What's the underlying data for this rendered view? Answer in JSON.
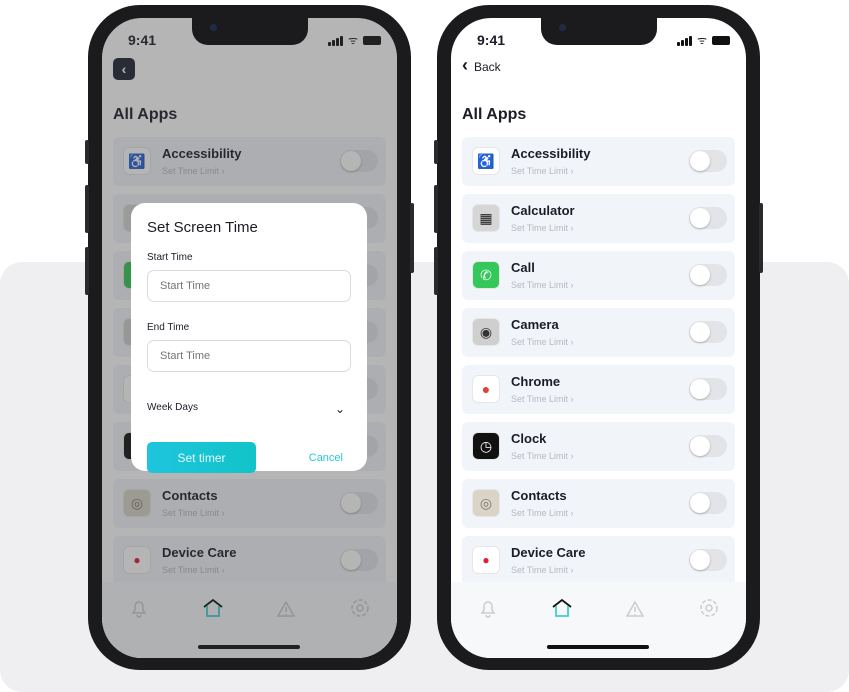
{
  "status": {
    "time": "9:41"
  },
  "header": {
    "back_label": "Back",
    "title": "All Apps"
  },
  "apps": [
    {
      "name": "Accessibility",
      "sub": "Set Time Limit",
      "icon": "accessibility-icon",
      "glyph": "♿",
      "bg": "#ffffff",
      "fg": "#3b82f6"
    },
    {
      "name": "Calculator",
      "sub": "Set Time Limit",
      "icon": "calculator-icon",
      "glyph": "▦",
      "bg": "#d6d6d6",
      "fg": "#222"
    },
    {
      "name": "Call",
      "sub": "Set Time Limit",
      "icon": "phone-icon",
      "glyph": "✆",
      "bg": "#34c759",
      "fg": "#fff"
    },
    {
      "name": "Camera",
      "sub": "Set Time Limit",
      "icon": "camera-icon",
      "glyph": "◉",
      "bg": "#cfcfcf",
      "fg": "#333"
    },
    {
      "name": "Chrome",
      "sub": "Set Time Limit",
      "icon": "chrome-icon",
      "glyph": "●",
      "bg": "#ffffff",
      "fg": "#db4437"
    },
    {
      "name": "Clock",
      "sub": "Set Time Limit",
      "icon": "clock-icon",
      "glyph": "◷",
      "bg": "#111111",
      "fg": "#fff"
    },
    {
      "name": "Contacts",
      "sub": "Set Time Limit",
      "icon": "contacts-icon",
      "glyph": "◎",
      "bg": "#d9d4c6",
      "fg": "#777"
    },
    {
      "name": "Device Care",
      "sub": "Set Time Limit",
      "icon": "device-care-icon",
      "glyph": "",
      "bg": "#ffffff",
      "fg": "#e11d2e"
    }
  ],
  "tabs": [
    {
      "icon": "bell-icon"
    },
    {
      "icon": "home-icon",
      "active": true
    },
    {
      "icon": "alert-icon"
    },
    {
      "icon": "settings-icon"
    }
  ],
  "modal": {
    "title": "Set Screen Time",
    "start_label": "Start Time",
    "start_placeholder": "Start Time",
    "end_label": "End Time",
    "end_placeholder": "Start Time",
    "weekdays_label": "Week Days",
    "set_label": "Set timer",
    "cancel_label": "Cancel"
  },
  "colors": {
    "accent": "#1ec5dc",
    "card": "#f1f4f8"
  }
}
